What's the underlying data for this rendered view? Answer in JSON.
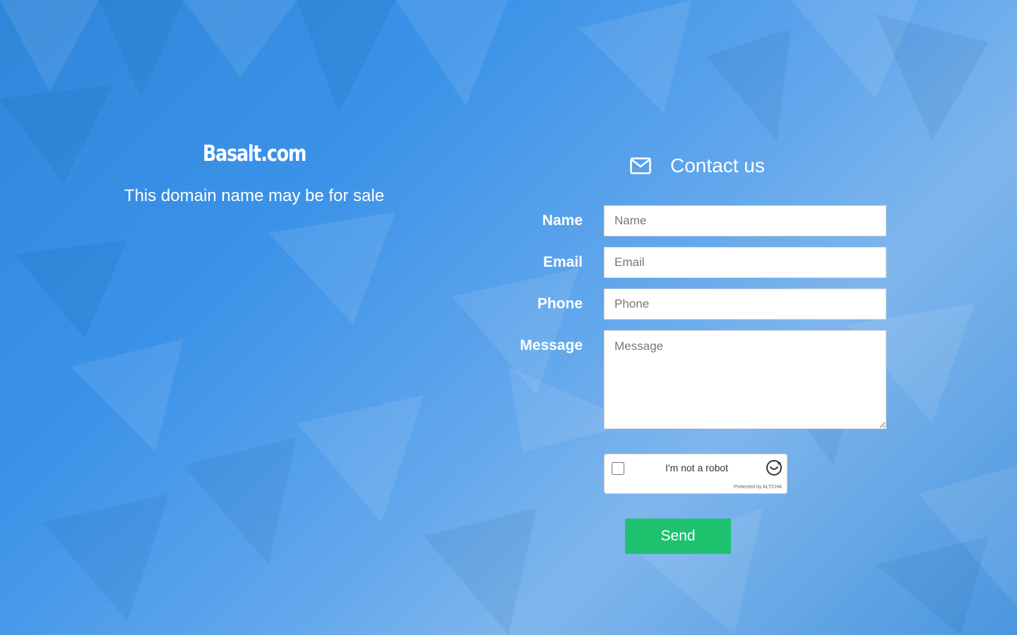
{
  "site": {
    "title": "Basalt.com",
    "subtitle": "This domain name may be for sale"
  },
  "contact": {
    "title": "Contact us",
    "icon": "envelope-icon"
  },
  "form": {
    "fields": [
      {
        "label": "Name",
        "placeholder": "Name",
        "value": ""
      },
      {
        "label": "Email",
        "placeholder": "Email",
        "value": ""
      },
      {
        "label": "Phone",
        "placeholder": "Phone",
        "value": ""
      },
      {
        "label": "Message",
        "placeholder": "Message",
        "value": ""
      }
    ],
    "send_label": "Send"
  },
  "captcha": {
    "label": "I'm not a robot",
    "footer": "Protected by ALTCHA",
    "checked": false,
    "icon": "altcha-logo-icon"
  },
  "colors": {
    "background": "#3b92e8",
    "send_button": "#1ec26f",
    "text": "#ffffff"
  }
}
